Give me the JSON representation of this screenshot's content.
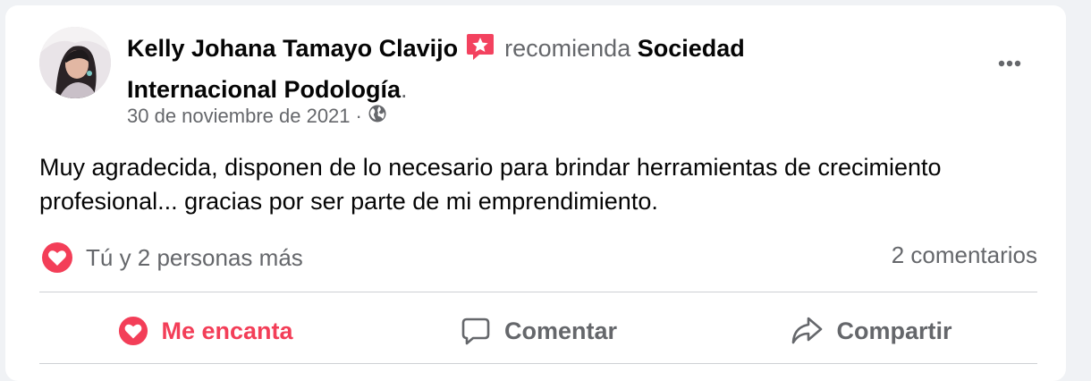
{
  "post": {
    "author_name": "Kelly Johana Tamayo Clavijo",
    "recommends_text": "recomienda",
    "page_name": "Sociedad Internacional Podología",
    "period": ".",
    "date": "30 de noviembre de 2021",
    "separator": "·",
    "privacy_icon": "globe-icon",
    "body": "Muy agradecida, disponen de lo necesario para brindar herramientas de crecimiento profesional... gracias por ser parte de mi emprendimiento."
  },
  "stats": {
    "reaction_icon": "love-reaction-icon",
    "reactions_text": "Tú y 2 personas más",
    "comments_text": "2 comentarios"
  },
  "actions": {
    "love_label": "Me encanta",
    "comment_label": "Comentar",
    "share_label": "Compartir"
  },
  "colors": {
    "love": "#f33e58",
    "muted_text": "#65676b",
    "recommend_badge": "#f3425f"
  }
}
